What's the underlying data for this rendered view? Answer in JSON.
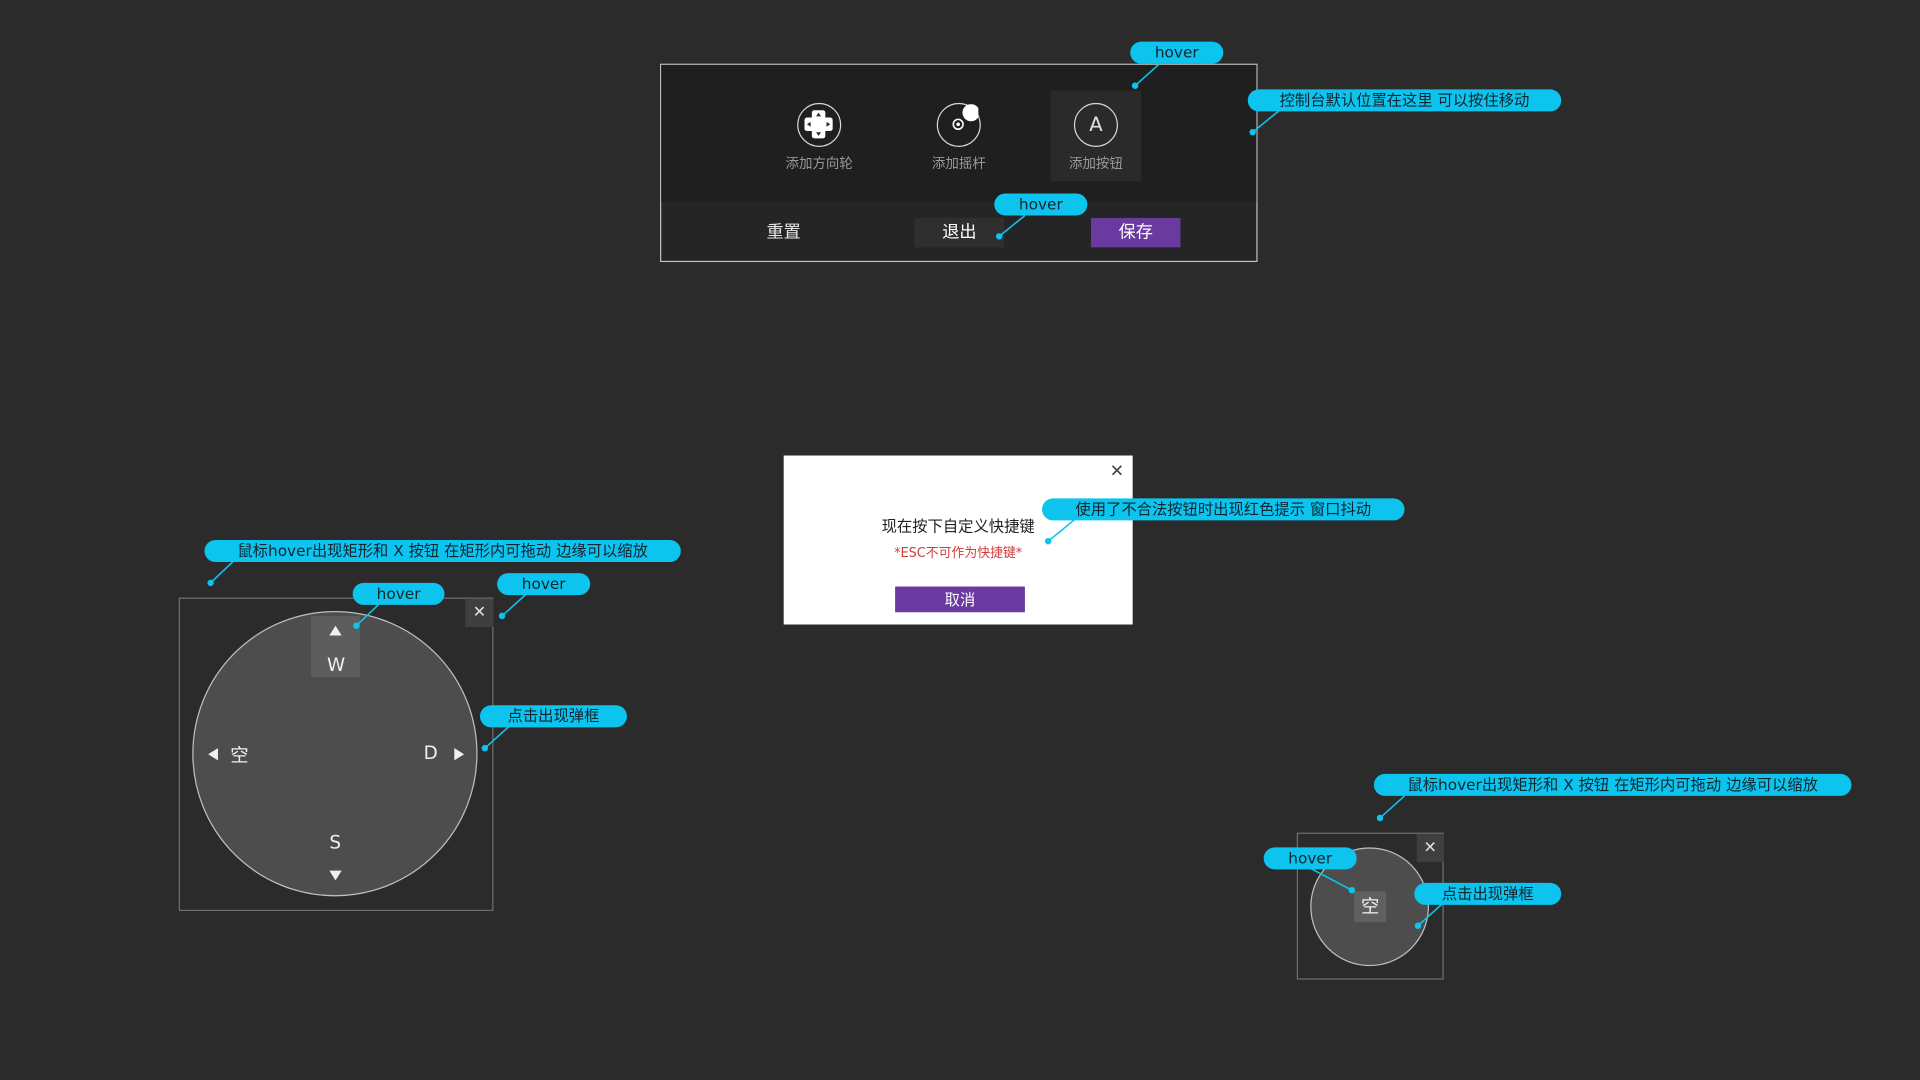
{
  "console": {
    "tools": [
      {
        "label": "添加方向轮"
      },
      {
        "label": "添加摇杆"
      },
      {
        "label": "添加按钮",
        "icon_text": "A"
      }
    ],
    "buttons": {
      "reset": "重置",
      "exit": "退出",
      "save": "保存"
    }
  },
  "dialog": {
    "close_glyph": "✕",
    "title": "现在按下自定义快捷键",
    "error": "*ESC不可作为快捷键*",
    "cancel": "取消"
  },
  "wheel": {
    "close_glyph": "✕",
    "up": "W",
    "down": "S",
    "left": "空",
    "right": "D"
  },
  "small_button": {
    "close_glyph": "✕",
    "key": "空"
  },
  "annotations": {
    "hover_console": "hover",
    "console_position": "控制台默认位置在这里 可以按住移动",
    "hover_exit": "hover",
    "illegal_key": "使用了不合法按钮时出现红色提示 窗口抖动",
    "wheel_hover_rect": "鼠标hover出现矩形和 X 按钮 在矩形内可拖动 边缘可以缩放",
    "wheel_hover_key": "hover",
    "wheel_hover_close": "hover",
    "wheel_click": "点击出现弹框",
    "small_hover_rect": "鼠标hover出现矩形和 X 按钮 在矩形内可拖动 边缘可以缩放",
    "small_hover": "hover",
    "small_click": "点击出现弹框"
  },
  "colors": {
    "background": "#2b2b2b",
    "accent_purple": "#6b3aa0",
    "annotation_cyan": "#0cc4ee",
    "error_red": "#d43b3b"
  }
}
